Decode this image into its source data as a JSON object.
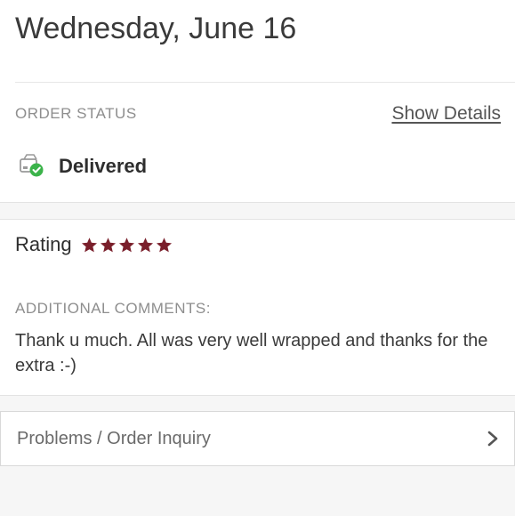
{
  "header": {
    "date": "Wednesday, June 16"
  },
  "order_status": {
    "label": "ORDER STATUS",
    "show_details_label": "Show Details",
    "status": "Delivered",
    "status_icon": "delivered-package-check-icon",
    "status_color": "#3bb34a"
  },
  "rating": {
    "label": "Rating",
    "stars": 5,
    "max_stars": 5,
    "star_color": "#7a1f2b"
  },
  "comments": {
    "label": "ADDITIONAL COMMENTS:",
    "text": "Thank u much. All was very well wrapped and thanks for the extra :-)"
  },
  "inquiry": {
    "label": "Problems / Order Inquiry",
    "icon": "chevron-right-icon"
  }
}
